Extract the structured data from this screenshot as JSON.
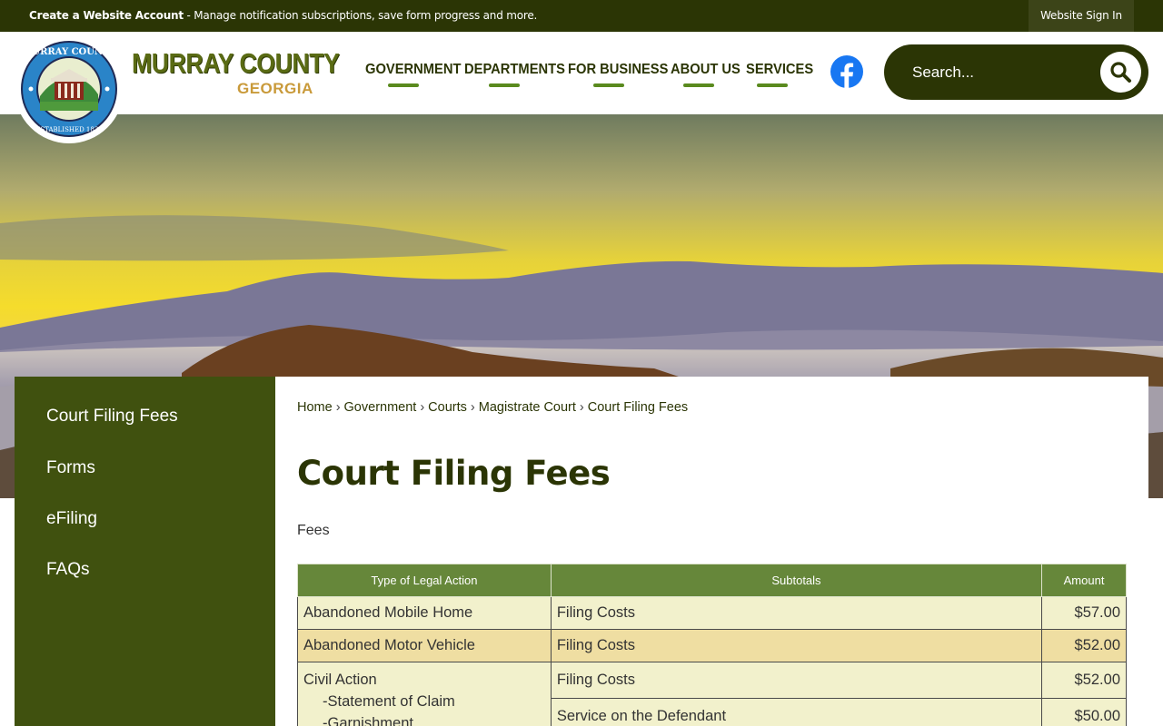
{
  "topbar": {
    "create_account_bold": "Create a Website Account",
    "create_account_rest": " - Manage notification subscriptions, save form progress and more.",
    "sign_in": "Website Sign In"
  },
  "brand": {
    "seal_text_top": "MURRAY COUNTY",
    "seal_text_bottom": "ESTABLISHED 1832",
    "title": "MURRAY COUNTY",
    "subtitle": "GEORGIA"
  },
  "nav": {
    "items": [
      {
        "label": "GOVERNMENT"
      },
      {
        "label": "DEPARTMENTS"
      },
      {
        "label": "FOR BUSINESS"
      },
      {
        "label": "ABOUT US"
      },
      {
        "label": "SERVICES"
      }
    ]
  },
  "search": {
    "placeholder": "Search..."
  },
  "sidebar": {
    "items": [
      {
        "label": "Court Filing Fees"
      },
      {
        "label": "Forms"
      },
      {
        "label": "eFiling"
      },
      {
        "label": "FAQs"
      }
    ]
  },
  "breadcrumb": {
    "items": [
      "Home",
      "Government",
      "Courts",
      "Magistrate Court",
      "Court Filing Fees"
    ],
    "separator": "›"
  },
  "page": {
    "title": "Court Filing Fees",
    "intro": "Fees"
  },
  "fees_table": {
    "headers": [
      "Type of Legal Action",
      "Subtotals",
      "Amount"
    ],
    "rows": [
      {
        "action": "Abandoned Mobile Home",
        "subtotal": "Filing Costs",
        "amount": "$57.00"
      },
      {
        "action": "Abandoned Motor Vehicle",
        "subtotal": "Filing Costs",
        "amount": "$52.00"
      },
      {
        "action": "Civil Action",
        "sub_actions": [
          "-Statement of Claim",
          "-Garnishment"
        ],
        "lines": [
          {
            "subtotal": "Filing Costs",
            "amount": "$52.00"
          },
          {
            "subtotal": "Service on the Defendant",
            "amount": "$50.00"
          }
        ]
      }
    ]
  },
  "colors": {
    "topbar": "#2b3505",
    "sidebar": "#40510f",
    "table_header": "#66873a",
    "row_light": "#f2f1cc",
    "row_highlight": "#efdea2"
  }
}
